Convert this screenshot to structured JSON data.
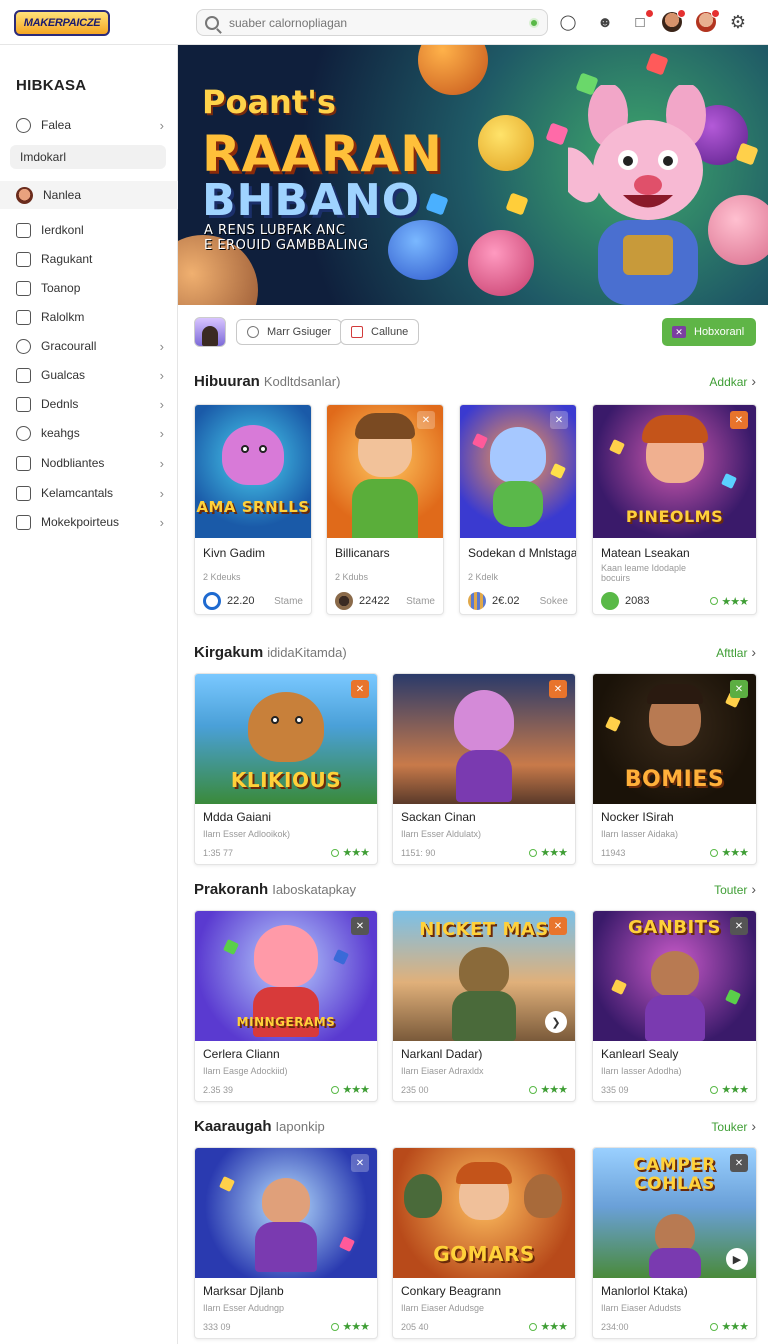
{
  "header": {
    "logo_text": "MAKERPAICZE",
    "search_placeholder": "suaber calornopliagan"
  },
  "sidebar": {
    "title": "HIBKASA",
    "items": [
      {
        "label": "Falea",
        "icon": "user-icon",
        "chevron": true
      },
      {
        "label": "Imdokarl",
        "icon": "",
        "chevron": false
      },
      {
        "label": "Nanlea",
        "icon": "avatar",
        "chevron": false
      },
      {
        "label": "Ierdkonl",
        "icon": "image-icon",
        "chevron": false
      },
      {
        "label": "Ragukant",
        "icon": "list-icon",
        "chevron": false
      },
      {
        "label": "Toanop",
        "icon": "message-icon",
        "chevron": false
      },
      {
        "label": "Ralolkm",
        "icon": "document-icon",
        "chevron": false
      },
      {
        "label": "Gracourall",
        "icon": "gamepad-icon",
        "chevron": true
      },
      {
        "label": "Gualcas",
        "icon": "monitor-icon",
        "chevron": true
      },
      {
        "label": "Dednls",
        "icon": "tag-icon",
        "chevron": true
      },
      {
        "label": "keahgs",
        "icon": "controller-icon",
        "chevron": true
      },
      {
        "label": "Nodbliantes",
        "icon": "grid-icon",
        "chevron": true
      },
      {
        "label": "Kelamcantals",
        "icon": "chart-icon",
        "chevron": true
      },
      {
        "label": "Mokekpoirteus",
        "icon": "edit-icon",
        "chevron": true
      }
    ]
  },
  "banner": {
    "line1": "Poant's",
    "line2": "RAARAN",
    "line3": "BHBANO",
    "sub1": "A RENS LUBFAK ANC",
    "sub2": "E EROUID GAMBBALING"
  },
  "actions": {
    "btn1": "Marr Gsiuger",
    "btn2": "Callune",
    "primary": "Hobxoranl"
  },
  "sections": [
    {
      "title": "Hibuuran",
      "subtitle": "Kodltdsanlar)",
      "link": "Addkar",
      "cards": [
        {
          "title": "Kivn Gadim",
          "sub": "2 Kdeuks",
          "count": "22.20",
          "tag": "Stame",
          "art": "AMA SRNLLS"
        },
        {
          "title": "Billicanars",
          "sub": "2 Kdubs",
          "count": "22422",
          "tag": "Stame",
          "art": ""
        },
        {
          "title": "Sodekan d Mnlstaga",
          "sub": "2 Kdelk",
          "count": "2€.02",
          "tag": "Sokee",
          "art": ""
        },
        {
          "title": "Matean Lseakan",
          "sub": "Kaan leame Idodaple",
          "sub2": "bocuirs",
          "count": "2083",
          "rating": "★★★",
          "art": "PINEOLMS"
        }
      ]
    },
    {
      "title": "Kirgakum",
      "subtitle": "ididaKitamda)",
      "link": "Afttlar",
      "cards": [
        {
          "title": "Mdda Gaiani",
          "sub": "Ilarn Esser Adlooikok)",
          "count": "1:35 77",
          "rating": "★★★",
          "art": "KLIKIOUS"
        },
        {
          "title": "Sackan Cinan",
          "sub": "Ilarn Esser Aldulatx)",
          "count": "1151: 90",
          "rating": "★★★",
          "art": ""
        },
        {
          "title": "Nocker ISirah",
          "sub": "Ilarn Iasser Aidaka)",
          "count": "11943",
          "rating": "★★★",
          "art": "BOMIES"
        }
      ]
    },
    {
      "title": "Prakoranh",
      "subtitle": "Iaboskatapkay",
      "link": "Touter",
      "cards": [
        {
          "title": "Cerlera Cliann",
          "sub": "Ilarn Easge Adockiid)",
          "count": "2.35 39",
          "rating": "★★★",
          "art": "MINNGERAMS"
        },
        {
          "title": "Narkanl Dadar)",
          "sub": "Ilarn Eiaser Adraxldx",
          "count": "235 00",
          "rating": "★★★",
          "art": "NICKET MAS"
        },
        {
          "title": "Kanlearl Sealy",
          "sub": "Ilarn Iasser Adodha)",
          "count": "335 09",
          "rating": "★★★",
          "art": "GANBITS"
        }
      ]
    },
    {
      "title": "Kaaraugah",
      "subtitle": "Iaponkip",
      "link": "Touker",
      "cards": [
        {
          "title": "Marksar Djlanb",
          "sub": "Ilarn Esser Adudngp",
          "count": "333 09",
          "rating": "★★★",
          "art": ""
        },
        {
          "title": "Conkary Beagrann",
          "sub": "Ilarn Eiaser Adudsge",
          "count": "205 40",
          "rating": "★★★",
          "art": "GOMARS"
        },
        {
          "title": "Manlorlol Ktaka)",
          "sub": "Ilarn Eiaser Adudsts",
          "count": "234:00",
          "rating": "★★★",
          "art": "CAMPER COHLAS"
        }
      ]
    }
  ],
  "colors": {
    "accent": "#5fb547",
    "link": "#3f9e35",
    "badge": "#e53030"
  }
}
